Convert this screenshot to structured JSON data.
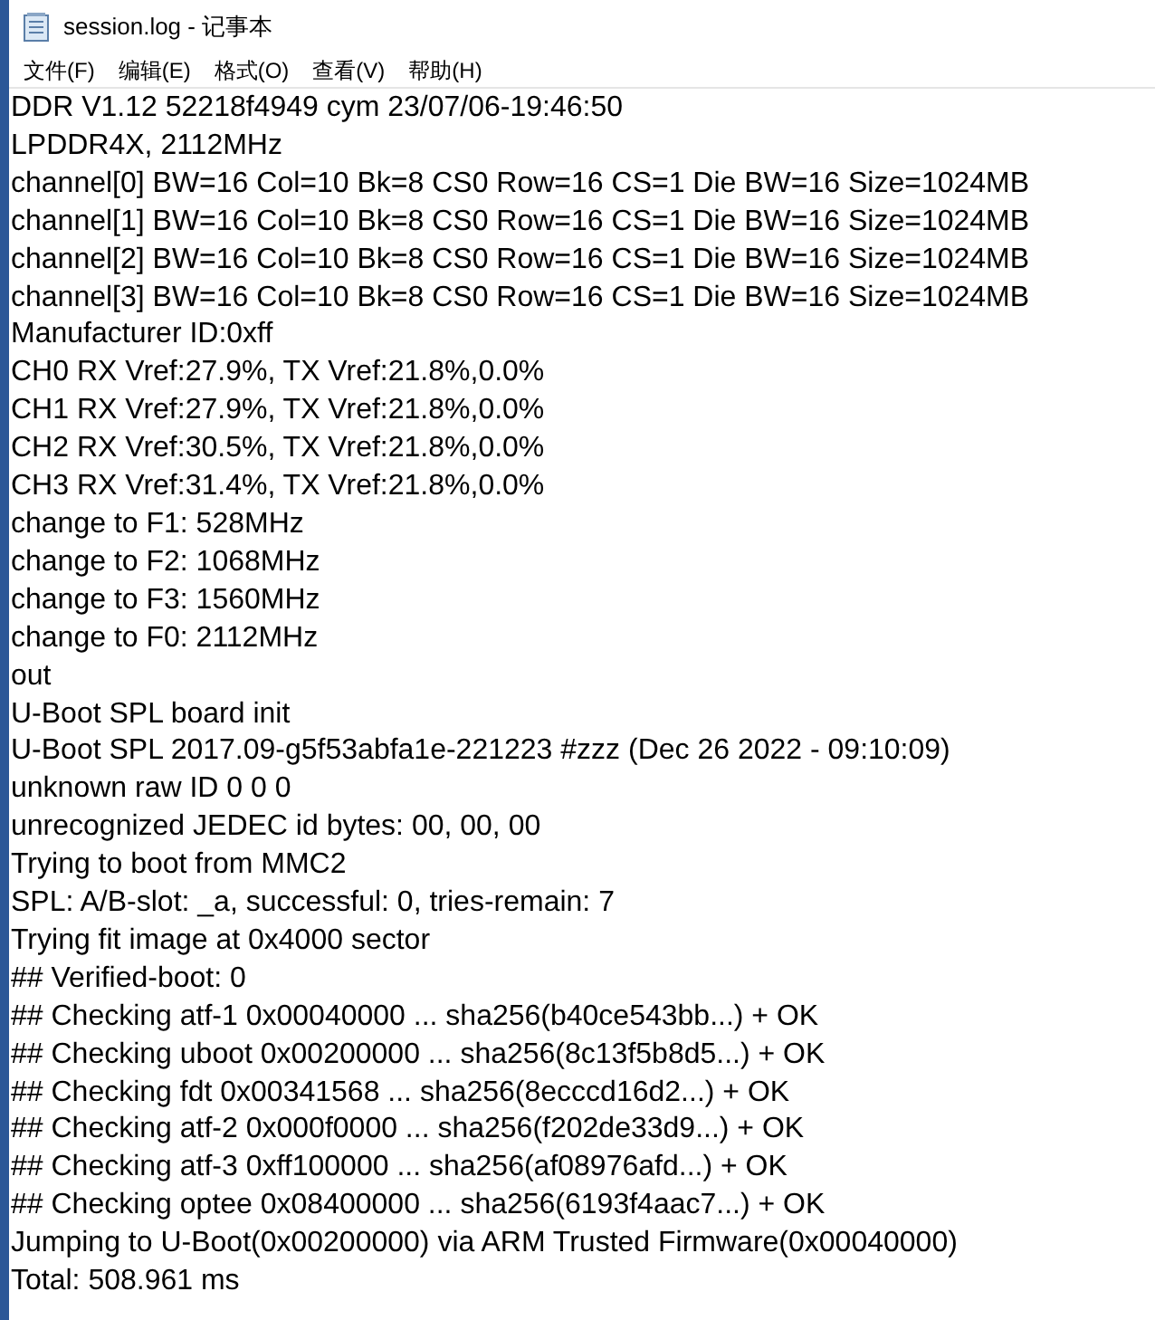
{
  "window": {
    "title": "session.log - 记事本"
  },
  "menu": [
    "文件(F)",
    "编辑(E)",
    "格式(O)",
    "查看(V)",
    "帮助(H)"
  ],
  "lines": [
    "DDR V1.12 52218f4949 cym 23/07/06-19:46:50",
    "LPDDR4X, 2112MHz",
    "channel[0] BW=16 Col=10 Bk=8 CS0 Row=16 CS=1 Die BW=16 Size=1024MB",
    "channel[1] BW=16 Col=10 Bk=8 CS0 Row=16 CS=1 Die BW=16 Size=1024MB",
    "channel[2] BW=16 Col=10 Bk=8 CS0 Row=16 CS=1 Die BW=16 Size=1024MB",
    "channel[3] BW=16 Col=10 Bk=8 CS0 Row=16 CS=1 Die BW=16 Size=1024MB",
    "Manufacturer ID:0xff",
    "CH0 RX Vref:27.9%, TX Vref:21.8%,0.0%",
    "CH1 RX Vref:27.9%, TX Vref:21.8%,0.0%",
    "CH2 RX Vref:30.5%, TX Vref:21.8%,0.0%",
    "CH3 RX Vref:31.4%, TX Vref:21.8%,0.0%",
    "change to F1: 528MHz",
    "change to F2: 1068MHz",
    "change to F3: 1560MHz",
    "change to F0: 2112MHz",
    "out",
    "U-Boot SPL board init",
    "U-Boot SPL 2017.09-g5f53abfa1e-221223 #zzz (Dec 26 2022 - 09:10:09)",
    "unknown raw ID 0 0 0",
    "unrecognized JEDEC id bytes: 00, 00, 00",
    "Trying to boot from MMC2",
    "SPL: A/B-slot: _a, successful: 0, tries-remain: 7",
    "Trying fit image at 0x4000 sector",
    "## Verified-boot: 0",
    "## Checking atf-1 0x00040000 ... sha256(b40ce543bb...) + OK",
    "## Checking uboot 0x00200000 ... sha256(8c13f5b8d5...) + OK",
    "## Checking fdt 0x00341568 ... sha256(8ecccd16d2...) + OK",
    "## Checking atf-2 0x000f0000 ... sha256(f202de33d9...) + OK",
    "## Checking atf-3 0xff100000 ... sha256(af08976afd...) + OK",
    "## Checking optee 0x08400000 ... sha256(6193f4aac7...) + OK",
    "Jumping to U-Boot(0x00200000) via ARM Trusted Firmware(0x00040000)",
    "Total: 508.961 ms"
  ]
}
